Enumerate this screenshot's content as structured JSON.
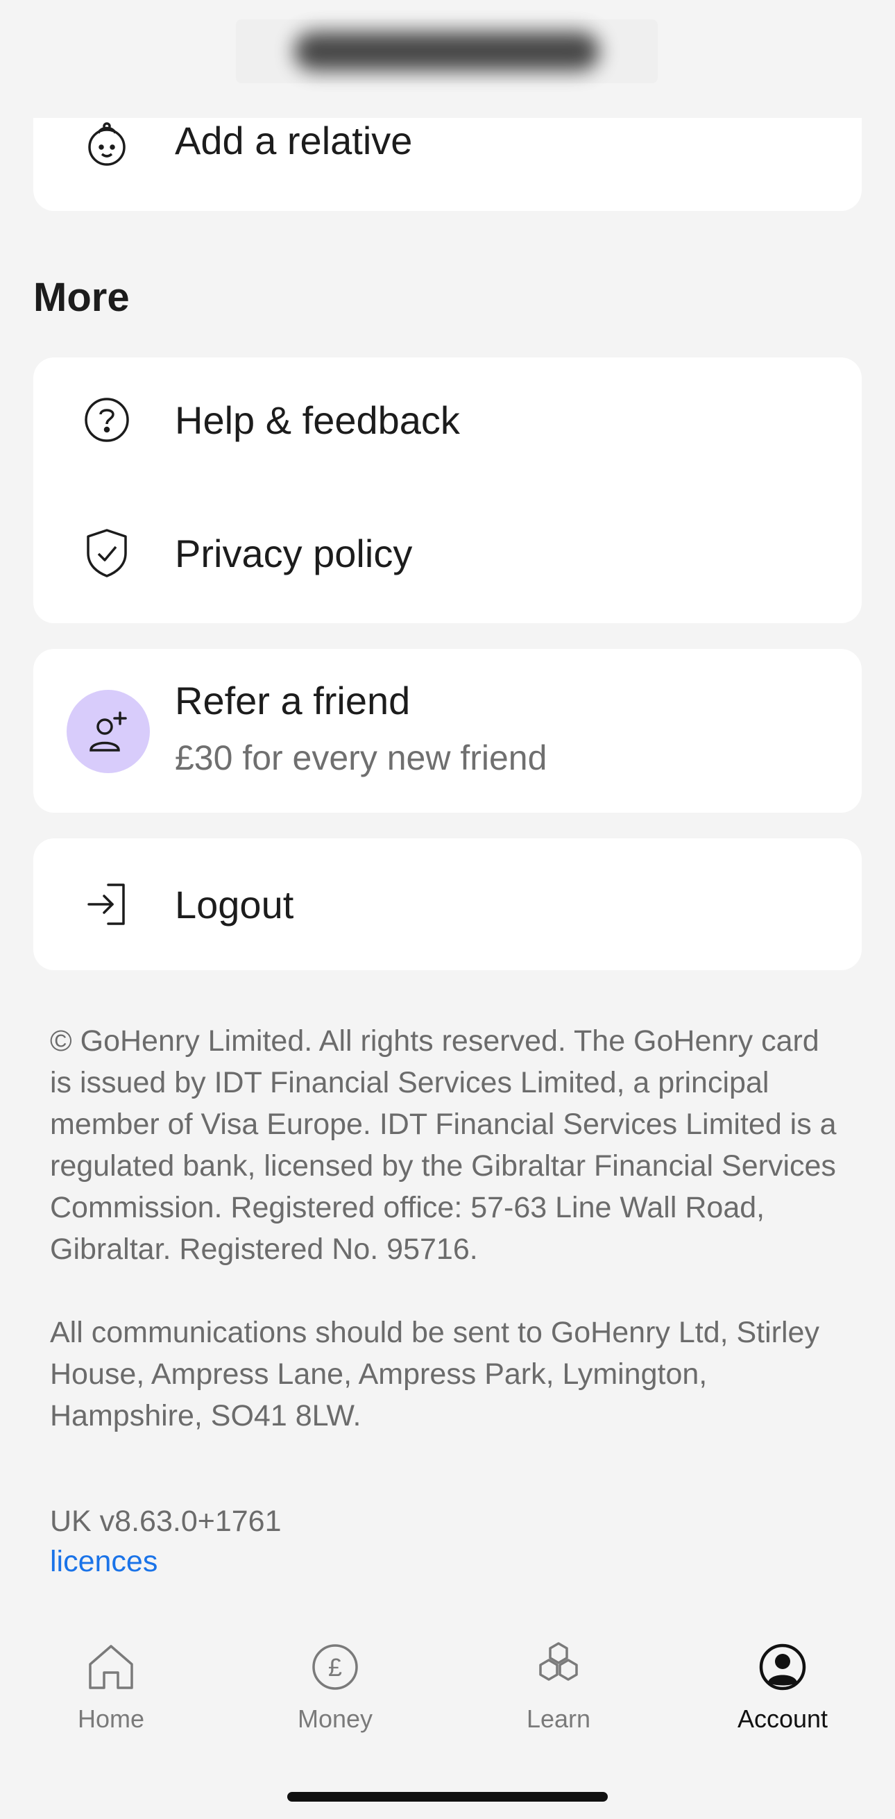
{
  "header": {
    "blurred_title": ""
  },
  "family": {
    "add_relative_label": "Add a relative"
  },
  "more": {
    "title": "More",
    "help_label": "Help & feedback",
    "privacy_label": "Privacy policy",
    "refer_title": "Refer a friend",
    "refer_subtitle": "£30 for every new friend",
    "logout_label": "Logout"
  },
  "legal": {
    "paragraph1": "© GoHenry Limited. All rights reserved. The GoHenry card is issued by IDT Financial Services Limited, a principal member of Visa Europe. IDT Financial Services Limited is a regulated bank, licensed by the Gibraltar Financial Services Commission. Registered office: 57-63 Line Wall Road, Gibraltar. Registered No. 95716.",
    "paragraph2": "All communications should be sent to GoHenry Ltd, Stirley House, Ampress Lane, Ampress Park, Lymington, Hampshire, SO41 8LW."
  },
  "footer": {
    "version": "UK v8.63.0+1761",
    "licences_link": "licences"
  },
  "tabs": [
    {
      "label": "Home",
      "icon": "home-icon"
    },
    {
      "label": "Money",
      "icon": "pound-icon"
    },
    {
      "label": "Learn",
      "icon": "hexagons-icon"
    },
    {
      "label": "Account",
      "icon": "account-icon"
    }
  ],
  "colors": {
    "background": "#f4f4f4",
    "card": "#ffffff",
    "accent_purple": "#d8ccfb",
    "link": "#1a73e8"
  }
}
